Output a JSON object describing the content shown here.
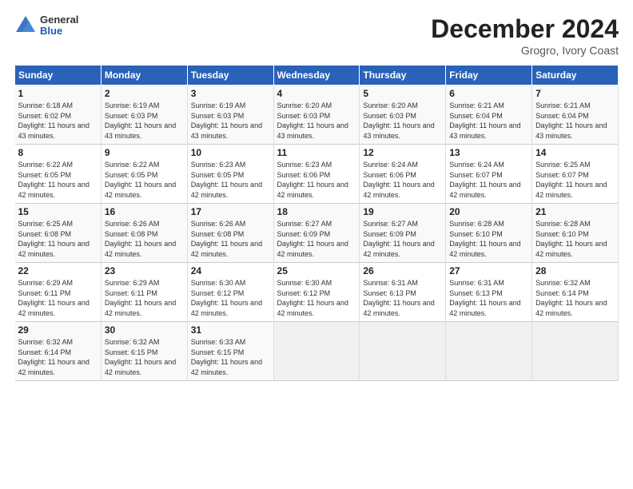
{
  "logo": {
    "general": "General",
    "blue": "Blue"
  },
  "title": "December 2024",
  "location": "Grogro, Ivory Coast",
  "days_header": [
    "Sunday",
    "Monday",
    "Tuesday",
    "Wednesday",
    "Thursday",
    "Friday",
    "Saturday"
  ],
  "weeks": [
    [
      {
        "day": "1",
        "sunrise": "Sunrise: 6:18 AM",
        "sunset": "Sunset: 6:02 PM",
        "daylight": "Daylight: 11 hours and 43 minutes."
      },
      {
        "day": "2",
        "sunrise": "Sunrise: 6:19 AM",
        "sunset": "Sunset: 6:03 PM",
        "daylight": "Daylight: 11 hours and 43 minutes."
      },
      {
        "day": "3",
        "sunrise": "Sunrise: 6:19 AM",
        "sunset": "Sunset: 6:03 PM",
        "daylight": "Daylight: 11 hours and 43 minutes."
      },
      {
        "day": "4",
        "sunrise": "Sunrise: 6:20 AM",
        "sunset": "Sunset: 6:03 PM",
        "daylight": "Daylight: 11 hours and 43 minutes."
      },
      {
        "day": "5",
        "sunrise": "Sunrise: 6:20 AM",
        "sunset": "Sunset: 6:03 PM",
        "daylight": "Daylight: 11 hours and 43 minutes."
      },
      {
        "day": "6",
        "sunrise": "Sunrise: 6:21 AM",
        "sunset": "Sunset: 6:04 PM",
        "daylight": "Daylight: 11 hours and 43 minutes."
      },
      {
        "day": "7",
        "sunrise": "Sunrise: 6:21 AM",
        "sunset": "Sunset: 6:04 PM",
        "daylight": "Daylight: 11 hours and 43 minutes."
      }
    ],
    [
      {
        "day": "8",
        "sunrise": "Sunrise: 6:22 AM",
        "sunset": "Sunset: 6:05 PM",
        "daylight": "Daylight: 11 hours and 42 minutes."
      },
      {
        "day": "9",
        "sunrise": "Sunrise: 6:22 AM",
        "sunset": "Sunset: 6:05 PM",
        "daylight": "Daylight: 11 hours and 42 minutes."
      },
      {
        "day": "10",
        "sunrise": "Sunrise: 6:23 AM",
        "sunset": "Sunset: 6:05 PM",
        "daylight": "Daylight: 11 hours and 42 minutes."
      },
      {
        "day": "11",
        "sunrise": "Sunrise: 6:23 AM",
        "sunset": "Sunset: 6:06 PM",
        "daylight": "Daylight: 11 hours and 42 minutes."
      },
      {
        "day": "12",
        "sunrise": "Sunrise: 6:24 AM",
        "sunset": "Sunset: 6:06 PM",
        "daylight": "Daylight: 11 hours and 42 minutes."
      },
      {
        "day": "13",
        "sunrise": "Sunrise: 6:24 AM",
        "sunset": "Sunset: 6:07 PM",
        "daylight": "Daylight: 11 hours and 42 minutes."
      },
      {
        "day": "14",
        "sunrise": "Sunrise: 6:25 AM",
        "sunset": "Sunset: 6:07 PM",
        "daylight": "Daylight: 11 hours and 42 minutes."
      }
    ],
    [
      {
        "day": "15",
        "sunrise": "Sunrise: 6:25 AM",
        "sunset": "Sunset: 6:08 PM",
        "daylight": "Daylight: 11 hours and 42 minutes."
      },
      {
        "day": "16",
        "sunrise": "Sunrise: 6:26 AM",
        "sunset": "Sunset: 6:08 PM",
        "daylight": "Daylight: 11 hours and 42 minutes."
      },
      {
        "day": "17",
        "sunrise": "Sunrise: 6:26 AM",
        "sunset": "Sunset: 6:08 PM",
        "daylight": "Daylight: 11 hours and 42 minutes."
      },
      {
        "day": "18",
        "sunrise": "Sunrise: 6:27 AM",
        "sunset": "Sunset: 6:09 PM",
        "daylight": "Daylight: 11 hours and 42 minutes."
      },
      {
        "day": "19",
        "sunrise": "Sunrise: 6:27 AM",
        "sunset": "Sunset: 6:09 PM",
        "daylight": "Daylight: 11 hours and 42 minutes."
      },
      {
        "day": "20",
        "sunrise": "Sunrise: 6:28 AM",
        "sunset": "Sunset: 6:10 PM",
        "daylight": "Daylight: 11 hours and 42 minutes."
      },
      {
        "day": "21",
        "sunrise": "Sunrise: 6:28 AM",
        "sunset": "Sunset: 6:10 PM",
        "daylight": "Daylight: 11 hours and 42 minutes."
      }
    ],
    [
      {
        "day": "22",
        "sunrise": "Sunrise: 6:29 AM",
        "sunset": "Sunset: 6:11 PM",
        "daylight": "Daylight: 11 hours and 42 minutes."
      },
      {
        "day": "23",
        "sunrise": "Sunrise: 6:29 AM",
        "sunset": "Sunset: 6:11 PM",
        "daylight": "Daylight: 11 hours and 42 minutes."
      },
      {
        "day": "24",
        "sunrise": "Sunrise: 6:30 AM",
        "sunset": "Sunset: 6:12 PM",
        "daylight": "Daylight: 11 hours and 42 minutes."
      },
      {
        "day": "25",
        "sunrise": "Sunrise: 6:30 AM",
        "sunset": "Sunset: 6:12 PM",
        "daylight": "Daylight: 11 hours and 42 minutes."
      },
      {
        "day": "26",
        "sunrise": "Sunrise: 6:31 AM",
        "sunset": "Sunset: 6:13 PM",
        "daylight": "Daylight: 11 hours and 42 minutes."
      },
      {
        "day": "27",
        "sunrise": "Sunrise: 6:31 AM",
        "sunset": "Sunset: 6:13 PM",
        "daylight": "Daylight: 11 hours and 42 minutes."
      },
      {
        "day": "28",
        "sunrise": "Sunrise: 6:32 AM",
        "sunset": "Sunset: 6:14 PM",
        "daylight": "Daylight: 11 hours and 42 minutes."
      }
    ],
    [
      {
        "day": "29",
        "sunrise": "Sunrise: 6:32 AM",
        "sunset": "Sunset: 6:14 PM",
        "daylight": "Daylight: 11 hours and 42 minutes."
      },
      {
        "day": "30",
        "sunrise": "Sunrise: 6:32 AM",
        "sunset": "Sunset: 6:15 PM",
        "daylight": "Daylight: 11 hours and 42 minutes."
      },
      {
        "day": "31",
        "sunrise": "Sunrise: 6:33 AM",
        "sunset": "Sunset: 6:15 PM",
        "daylight": "Daylight: 11 hours and 42 minutes."
      },
      null,
      null,
      null,
      null
    ]
  ]
}
